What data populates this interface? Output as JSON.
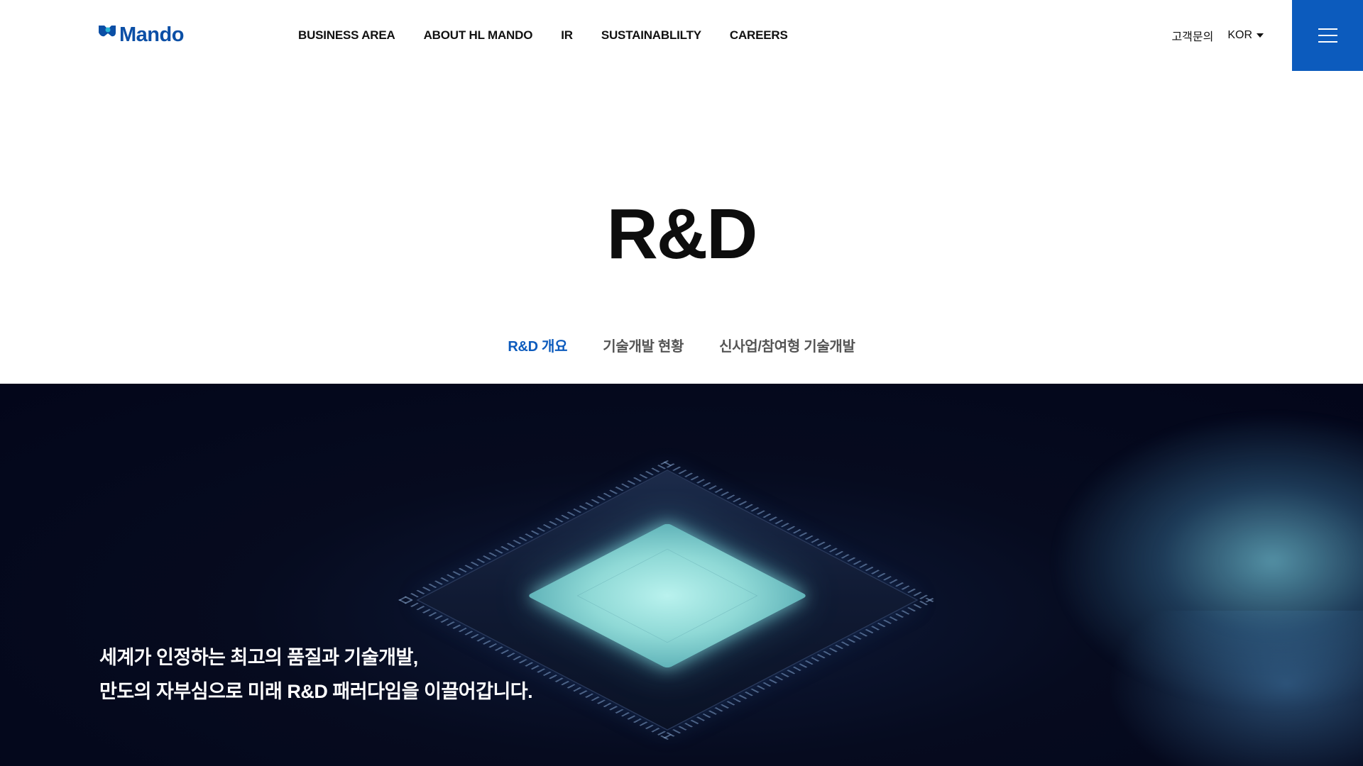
{
  "header": {
    "logo_text": "Mando",
    "nav": [
      {
        "label": "BUSINESS AREA"
      },
      {
        "label": "ABOUT HL MANDO"
      },
      {
        "label": "IR"
      },
      {
        "label": "SUSTAINABLILTY"
      },
      {
        "label": "CAREERS"
      }
    ],
    "customer_inquiry": "고객문의",
    "language": "KOR"
  },
  "page": {
    "title": "R&D"
  },
  "tabs": [
    {
      "label": "R&D 개요",
      "active": true
    },
    {
      "label": "기술개발 현황",
      "active": false
    },
    {
      "label": "신사업/참여형 기술개발",
      "active": false
    }
  ],
  "hero": {
    "line1": "세계가 인정하는 최고의 품질과 기술개발,",
    "line2": "만도의 자부심으로 미래 R&D 패러다임을 이끌어갑니다."
  },
  "colors": {
    "brand_blue": "#0c5bbd",
    "active_tab": "#0c5bbd",
    "hero_bg": "#060b1f",
    "chip_glow": "#a8ebe8"
  },
  "icons": {
    "menu": "hamburger-icon",
    "language_dropdown": "caret-down-icon",
    "logo_mark": "mando-logo-icon"
  }
}
